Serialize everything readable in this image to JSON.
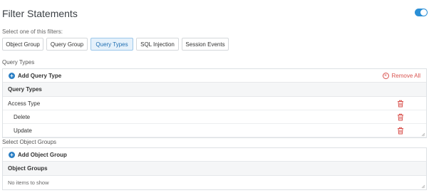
{
  "header": {
    "title": "Filter Statements",
    "enabled": true
  },
  "filters": {
    "hint": "Select one of this filters:",
    "tabs": [
      {
        "label": "Object Group",
        "active": false
      },
      {
        "label": "Query Group",
        "active": false
      },
      {
        "label": "Query Types",
        "active": true
      },
      {
        "label": "SQL Injection",
        "active": false
      },
      {
        "label": "Session Events",
        "active": false
      }
    ]
  },
  "query_types": {
    "section_label": "Query Types",
    "add_label": "Add Query Type",
    "remove_all_label": "Remove All",
    "column_header": "Query Types",
    "rows": [
      "Access Type",
      "Delete",
      "Update"
    ]
  },
  "object_groups": {
    "section_label": "Select Object Groups",
    "add_label": "Add Object Group",
    "column_header": "Object Groups",
    "empty_text": "No items to show"
  },
  "colors": {
    "accent": "#2b8fd6",
    "danger": "#d9534f",
    "active_tab_bg": "#e5f1fb"
  }
}
